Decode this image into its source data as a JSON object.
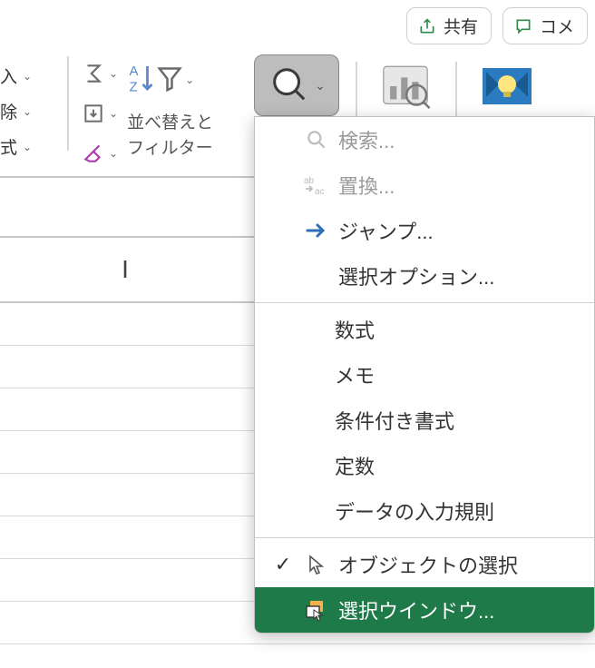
{
  "top": {
    "share": "共有",
    "comment": "コメ"
  },
  "ribbon": {
    "left": {
      "insert": "入",
      "delete": "除",
      "format": "式"
    },
    "sort_line1": "並べ替えと",
    "sort_line2": "フィルター"
  },
  "column_header": "I",
  "menu": {
    "find": "検索...",
    "replace": "置換...",
    "goto": "ジャンプ...",
    "special": "選択オプション...",
    "formulas": "数式",
    "notes": "メモ",
    "cond_format": "条件付き書式",
    "constants": "定数",
    "validation": "データの入力規則",
    "select_objects": "オブジェクトの選択",
    "selection_pane": "選択ウインドウ..."
  }
}
